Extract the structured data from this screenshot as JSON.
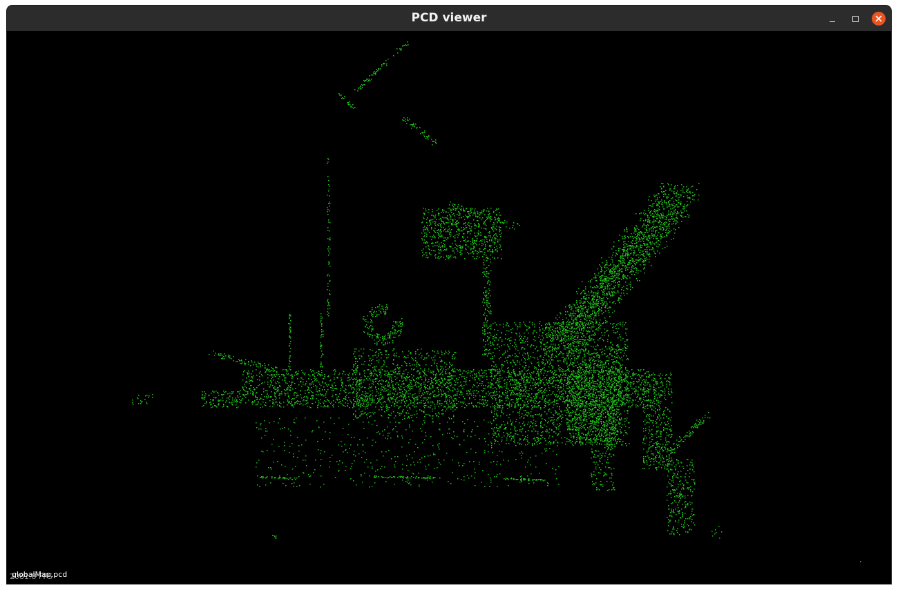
{
  "window": {
    "title": "PCD viewer"
  },
  "viewer": {
    "point_color": "#22c31a",
    "background": "#000000",
    "file_label": "globalMap.pcd",
    "fps_label": "2081.8 FPS"
  },
  "icons": {
    "minimize": "minimize-icon",
    "maximize": "maximize-icon",
    "close": "close-icon"
  }
}
